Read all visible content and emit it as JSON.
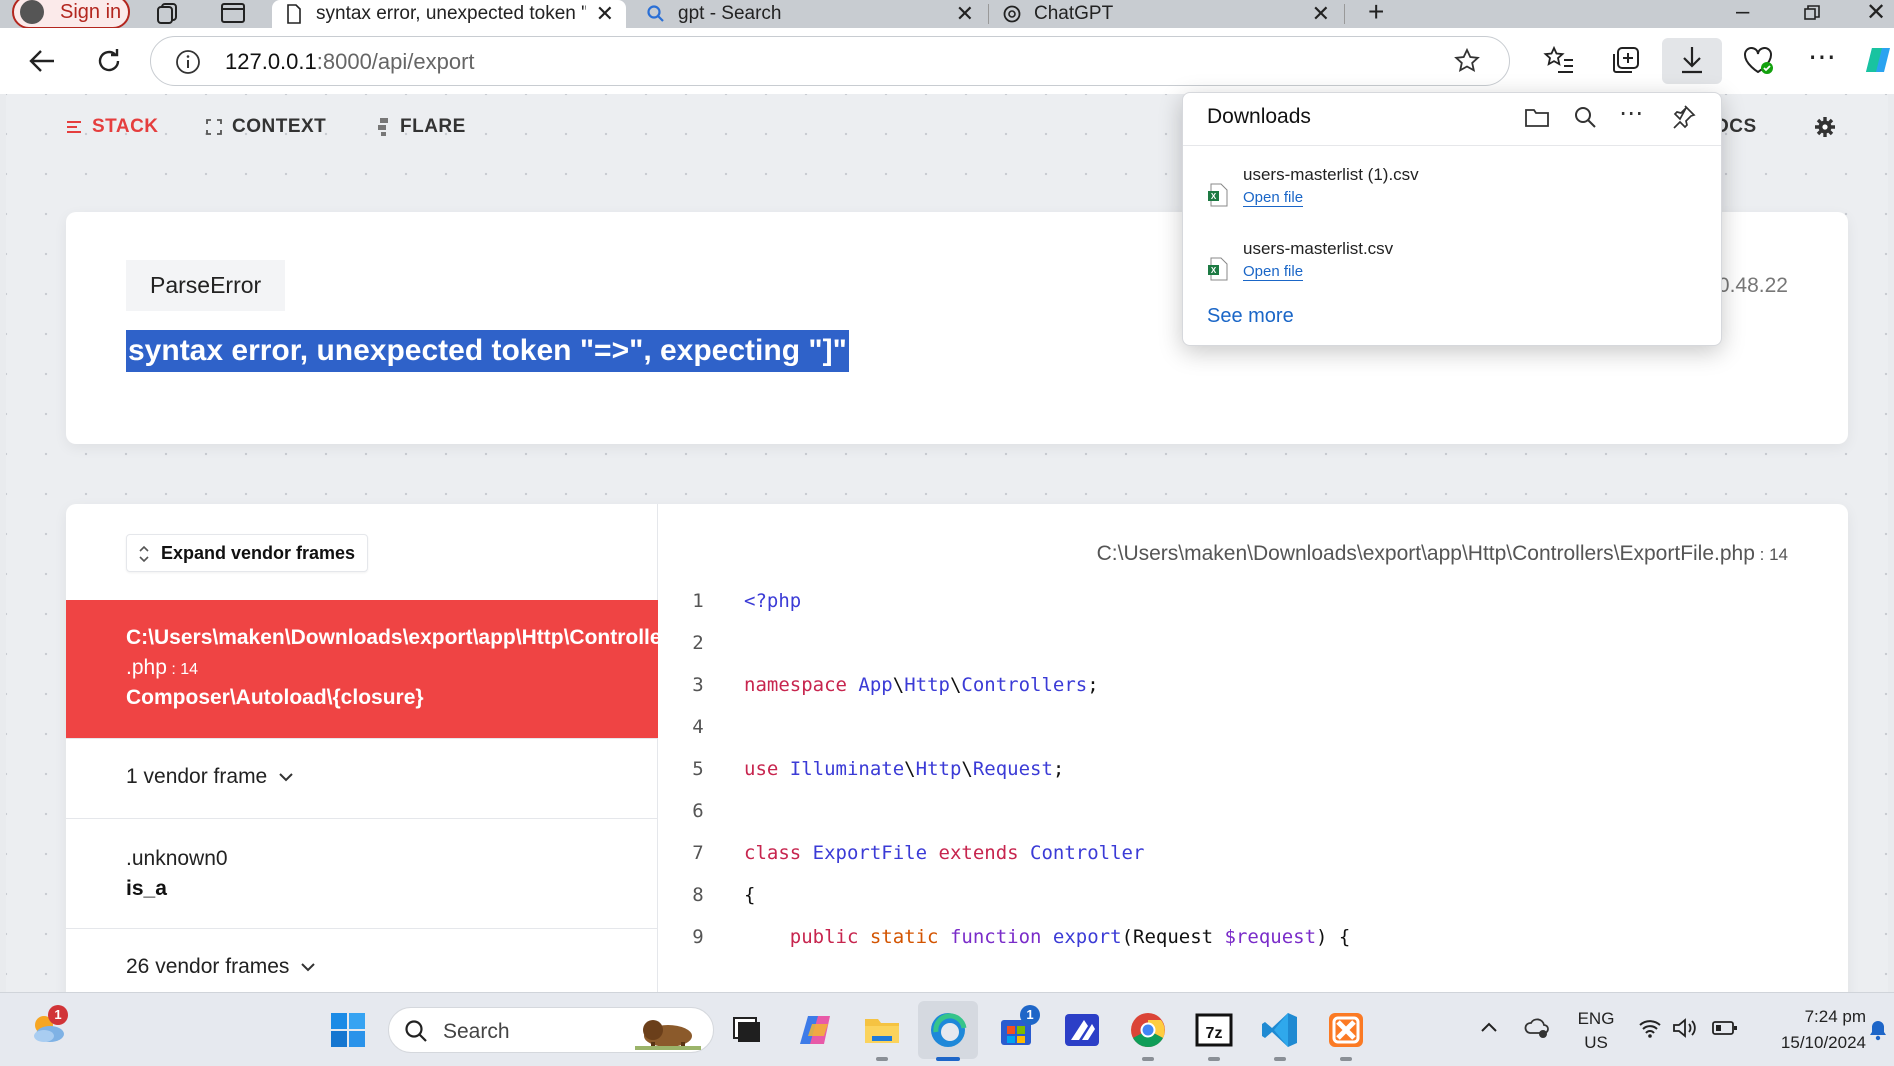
{
  "browser": {
    "signin_label": "Sign in",
    "tabs": [
      {
        "title": "syntax error, unexpected token \"=",
        "active": true
      },
      {
        "title": "gpt - Search",
        "active": false
      },
      {
        "title": "ChatGPT",
        "active": false
      }
    ],
    "new_tab_label": "+",
    "address": {
      "host": "127.0.0.1",
      "rest": ":8000/api/export"
    }
  },
  "downloads": {
    "title": "Downloads",
    "items": [
      {
        "filename": "users-masterlist (1).csv",
        "action": "Open file"
      },
      {
        "filename": "users-masterlist.csv",
        "action": "Open file"
      }
    ],
    "see_more": "See more"
  },
  "ignition": {
    "nav": {
      "stack": "STACK",
      "context": "CONTEXT",
      "flare": "FLARE",
      "docs_partial": "OCS"
    },
    "exception_class": "ParseError",
    "message": "syntax error, unexpected token \"=>\", expecting \"]\"",
    "version_partial": "0.48.22",
    "expand_vendor": "Expand vendor frames",
    "active_frame": {
      "path": "C:\\Users\\maken\\Downloads\\export\\app\\Http\\Controllers\\ExportFile",
      "ext": ".php",
      "line_sep": " : ",
      "line": "14",
      "method": "Composer\\Autoload\\{closure}"
    },
    "frames": [
      {
        "label": "1 vendor frame"
      },
      {
        "label": ".unknown0",
        "method": "is_a"
      },
      {
        "label": "26 vendor frames"
      }
    ],
    "code": {
      "file": "C:\\Users\\maken\\Downloads\\export\\app\\Http\\Controllers\\ExportFile",
      "file_ext": ".php",
      "line_sep": " : ",
      "line": "14",
      "line_numbers": [
        "1",
        "2",
        "3",
        "4",
        "5",
        "6",
        "7",
        "8",
        "9"
      ]
    }
  },
  "taskbar": {
    "search_label": "Search",
    "weather_badge": "1",
    "store_badge": "1",
    "lang_top": "ENG",
    "lang_bottom": "US",
    "time": "7:24 pm",
    "date": "15/10/2024"
  }
}
